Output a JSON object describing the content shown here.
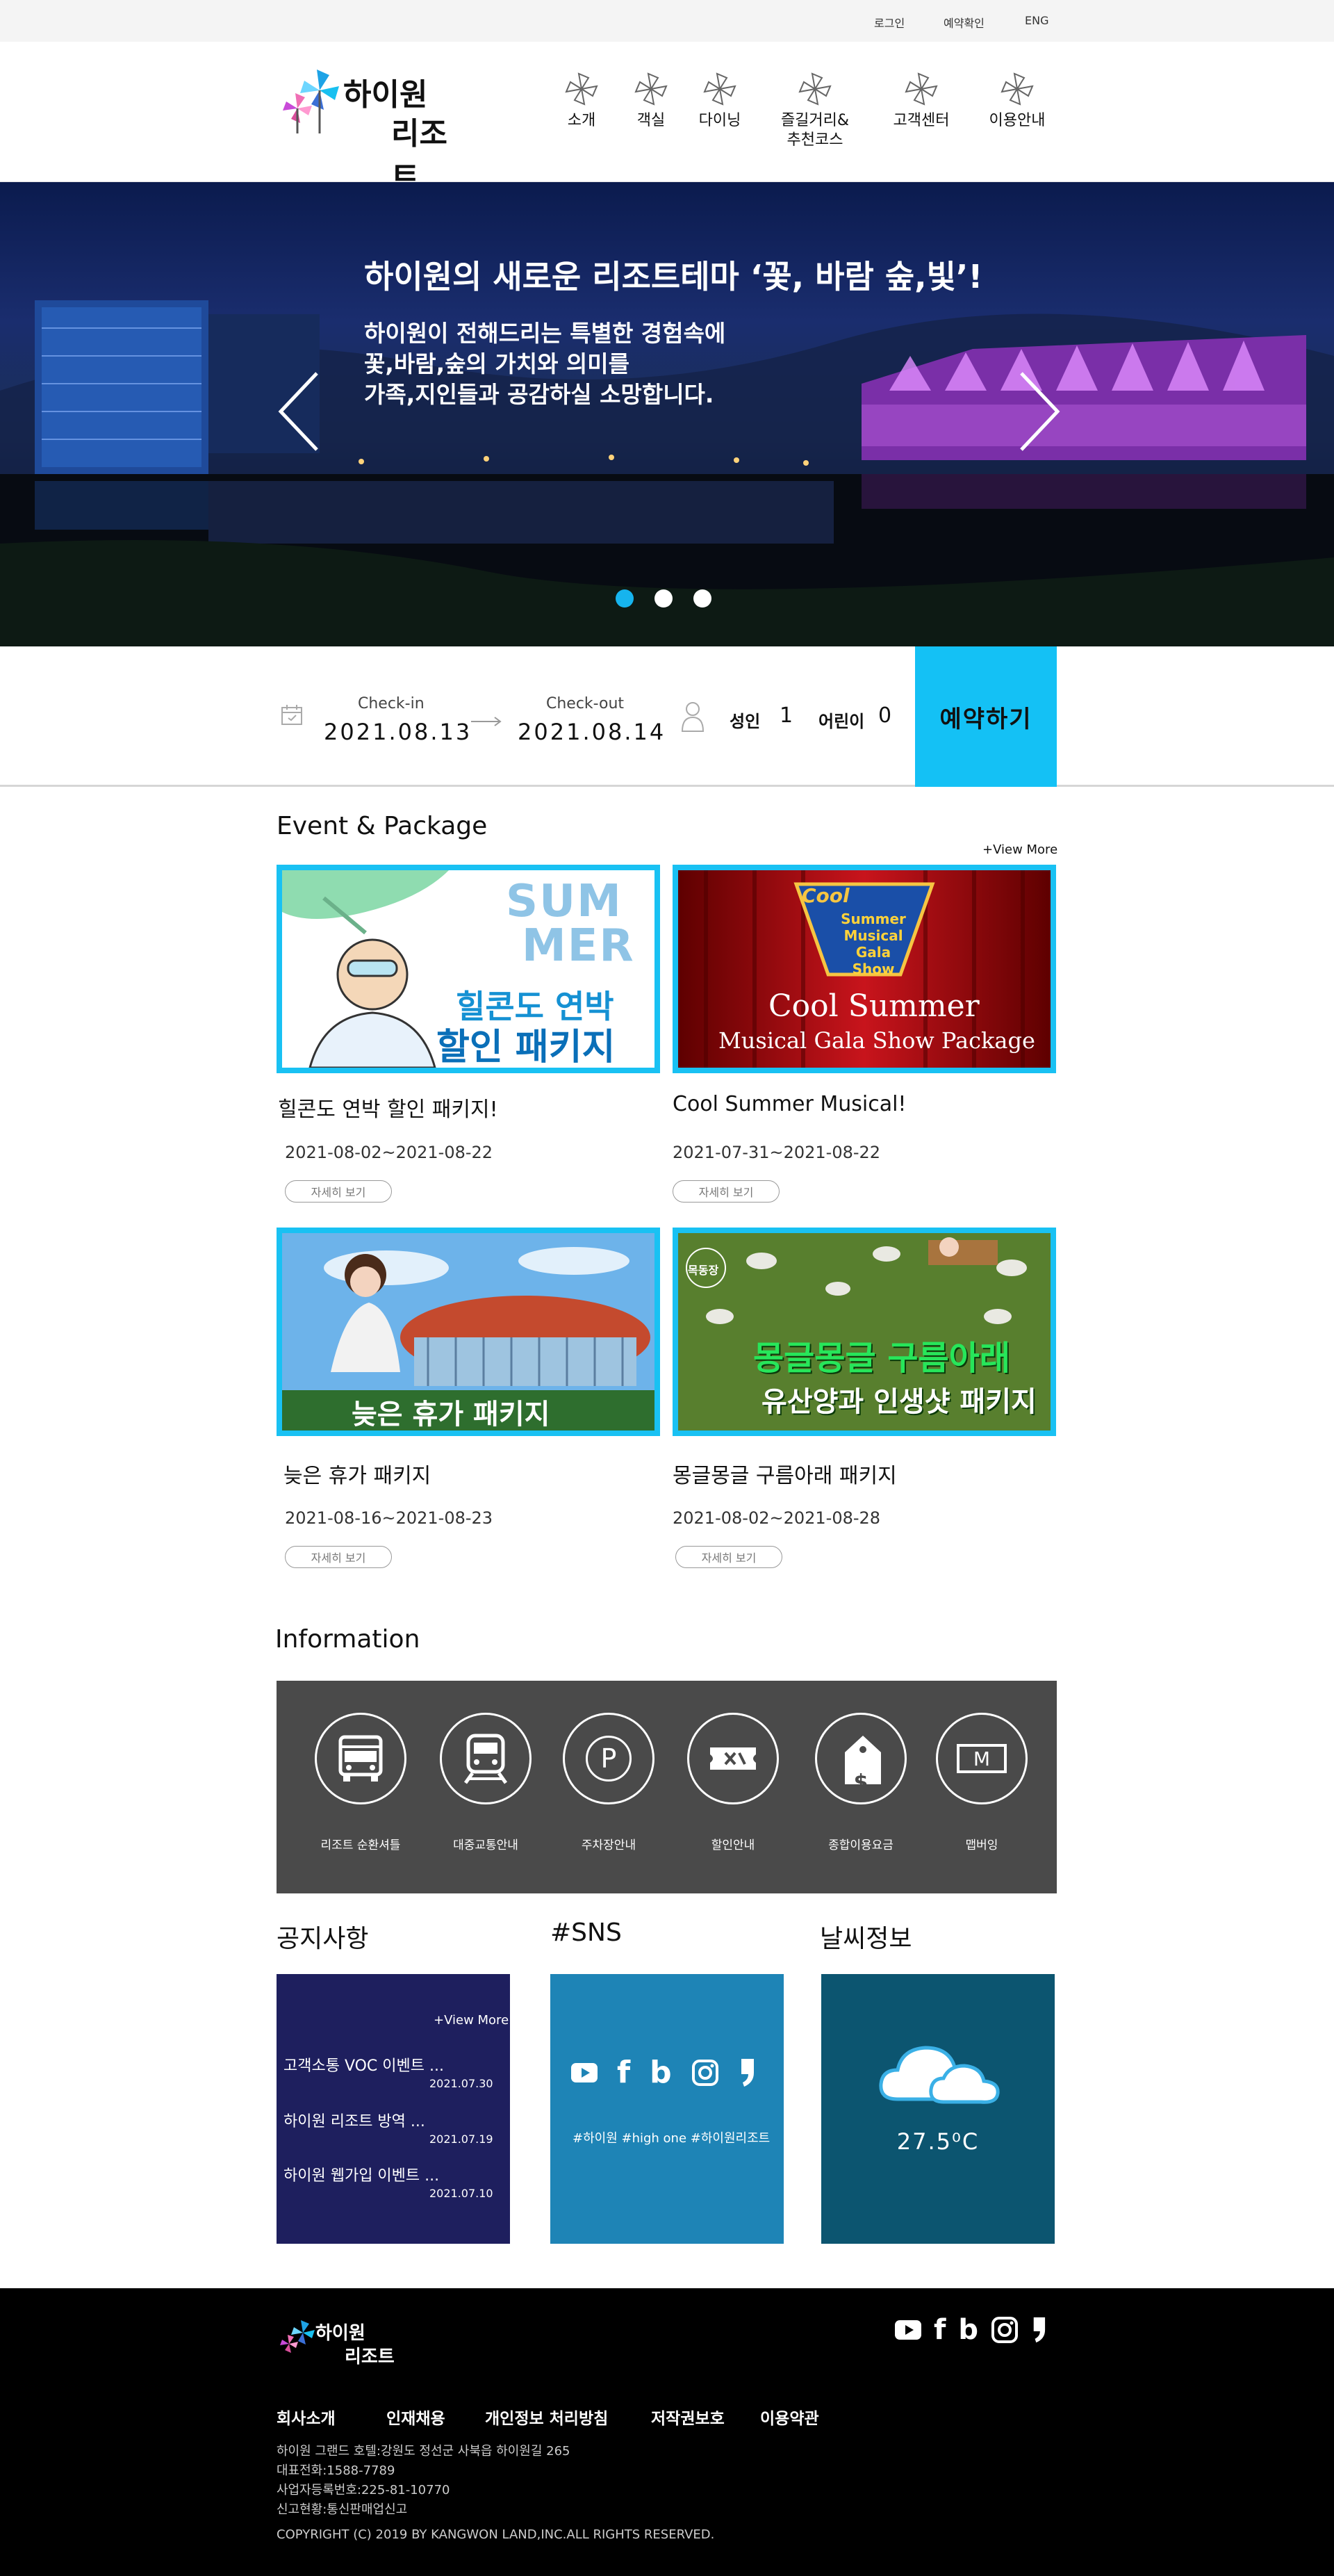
{
  "topbar": {
    "login": "로그인",
    "reservation_check": "예약확인",
    "lang": "ENG"
  },
  "brand": {
    "name_line1": "하이원",
    "name_line2": "리조트"
  },
  "nav": [
    {
      "label": "소개",
      "icon": "pinwheel-icon"
    },
    {
      "label": "객실",
      "icon": "pinwheel-icon"
    },
    {
      "label": "다이닝",
      "icon": "pinwheel-icon"
    },
    {
      "label": "즐길거리&",
      "label2": "추천코스",
      "icon": "pinwheel-icon"
    },
    {
      "label": "고객센터",
      "icon": "pinwheel-icon"
    },
    {
      "label": "이용안내",
      "icon": "pinwheel-icon"
    }
  ],
  "hero": {
    "title": "하이원의 새로운 리조트테마 ‘꽃, 바람 숲,빛’!",
    "line1": "하이원이 전해드리는 특별한 경험속에",
    "line2": "꽃,바람,숲의 가치와 의미를",
    "line3": "가족,지인들과 공감하실 소망합니다.",
    "slide_count": 3,
    "active_slide": 1
  },
  "booking": {
    "checkin_label": "Check-in",
    "checkin_date": "2021.08.13",
    "checkout_label": "Check-out",
    "checkout_date": "2021.08.14",
    "adult_label": "성인",
    "adult_count": "1",
    "child_label": "어린이",
    "child_count": "0",
    "reserve_label": "예약하기"
  },
  "events": {
    "title": "Event & Package",
    "view_more": "+View More",
    "detail_label": "자세히 보기",
    "items": [
      {
        "title": "힐콘도 연박 할인 패키지!",
        "date": "2021-08-02~2021-08-22",
        "banner1": "SUM",
        "banner2": "MER",
        "banner3": "힐콘도 연박",
        "banner4": "할인 패키지"
      },
      {
        "title": "Cool Summer Musical!",
        "date": "2021-07-31~2021-08-22",
        "banner1": "Cool",
        "banner2": "Summer Musical Gala Show",
        "banner3": "Cool Summer",
        "banner4": "Musical Gala Show Package"
      },
      {
        "title": "늦은 휴가 패키지",
        "date": "2021-08-16~2021-08-23",
        "banner3": "늦은 휴가 패키지"
      },
      {
        "title": "몽글몽글 구름아래 패키지",
        "date": "2021-08-02~2021-08-28",
        "banner1": "목동장",
        "banner3": "몽글몽글 구름아래",
        "banner4": "유산양과 인생샷 패키지"
      }
    ]
  },
  "information": {
    "title": "Information",
    "items": [
      {
        "label": "리조트 순환셔틀",
        "icon": "bus-icon"
      },
      {
        "label": "대중교통안내",
        "icon": "train-icon"
      },
      {
        "label": "주차장안내",
        "icon": "parking-icon",
        "glyph": "P"
      },
      {
        "label": "할인안내",
        "icon": "ticket-icon"
      },
      {
        "label": "종합이용요금",
        "icon": "price-tag-icon",
        "glyph": "$"
      },
      {
        "label": "맵버잉",
        "icon": "map-icon",
        "glyph": "M"
      }
    ]
  },
  "notice": {
    "title": "공지사항",
    "view_more": "+View More",
    "items": [
      {
        "text": "고객소통 VOC 이벤트 ...",
        "date": "2021.07.30"
      },
      {
        "text": "하이원 리조트 방역 ...",
        "date": "2021.07.19"
      },
      {
        "text": "하이원 웹가입 이벤트 ...",
        "date": "2021.07.10"
      }
    ]
  },
  "sns": {
    "title": "#SNS",
    "tags": "#하이원 #high one #하이원리조트",
    "icons": [
      "youtube-icon",
      "facebook-icon",
      "blog-icon",
      "instagram-icon",
      "kakao-icon"
    ],
    "glyph_f": "f",
    "glyph_b": "b"
  },
  "weather": {
    "title": "날씨정보",
    "temp": "27.5⁰C",
    "icon": "cloud-icon"
  },
  "footer": {
    "brand1": "하이원",
    "brand2": "리조트",
    "links": [
      "회사소개",
      "인재채용",
      "개인정보 처리방침",
      "저작권보호",
      "이용약관"
    ],
    "address": "하이원 그랜드 호텔:강원도 정선군 사북읍 하이원길 265",
    "phone": "대표전화:1588-7789",
    "biz": "사업자등록번호:225-81-10770",
    "mail_order": "신고현황:통신판매업신고",
    "copyright": "COPYRIGHT (C) 2019 BY KANGWON LAND,INC.ALL RIGHTS RESERVED.",
    "glyph_f": "f",
    "glyph_b": "b"
  },
  "colors": {
    "accent": "#14c1f5",
    "notice_bg": "#1e1f5e",
    "sns_bg": "#1e84b6",
    "weather_bg": "#0c5570",
    "info_bg": "#4a4a4a"
  }
}
